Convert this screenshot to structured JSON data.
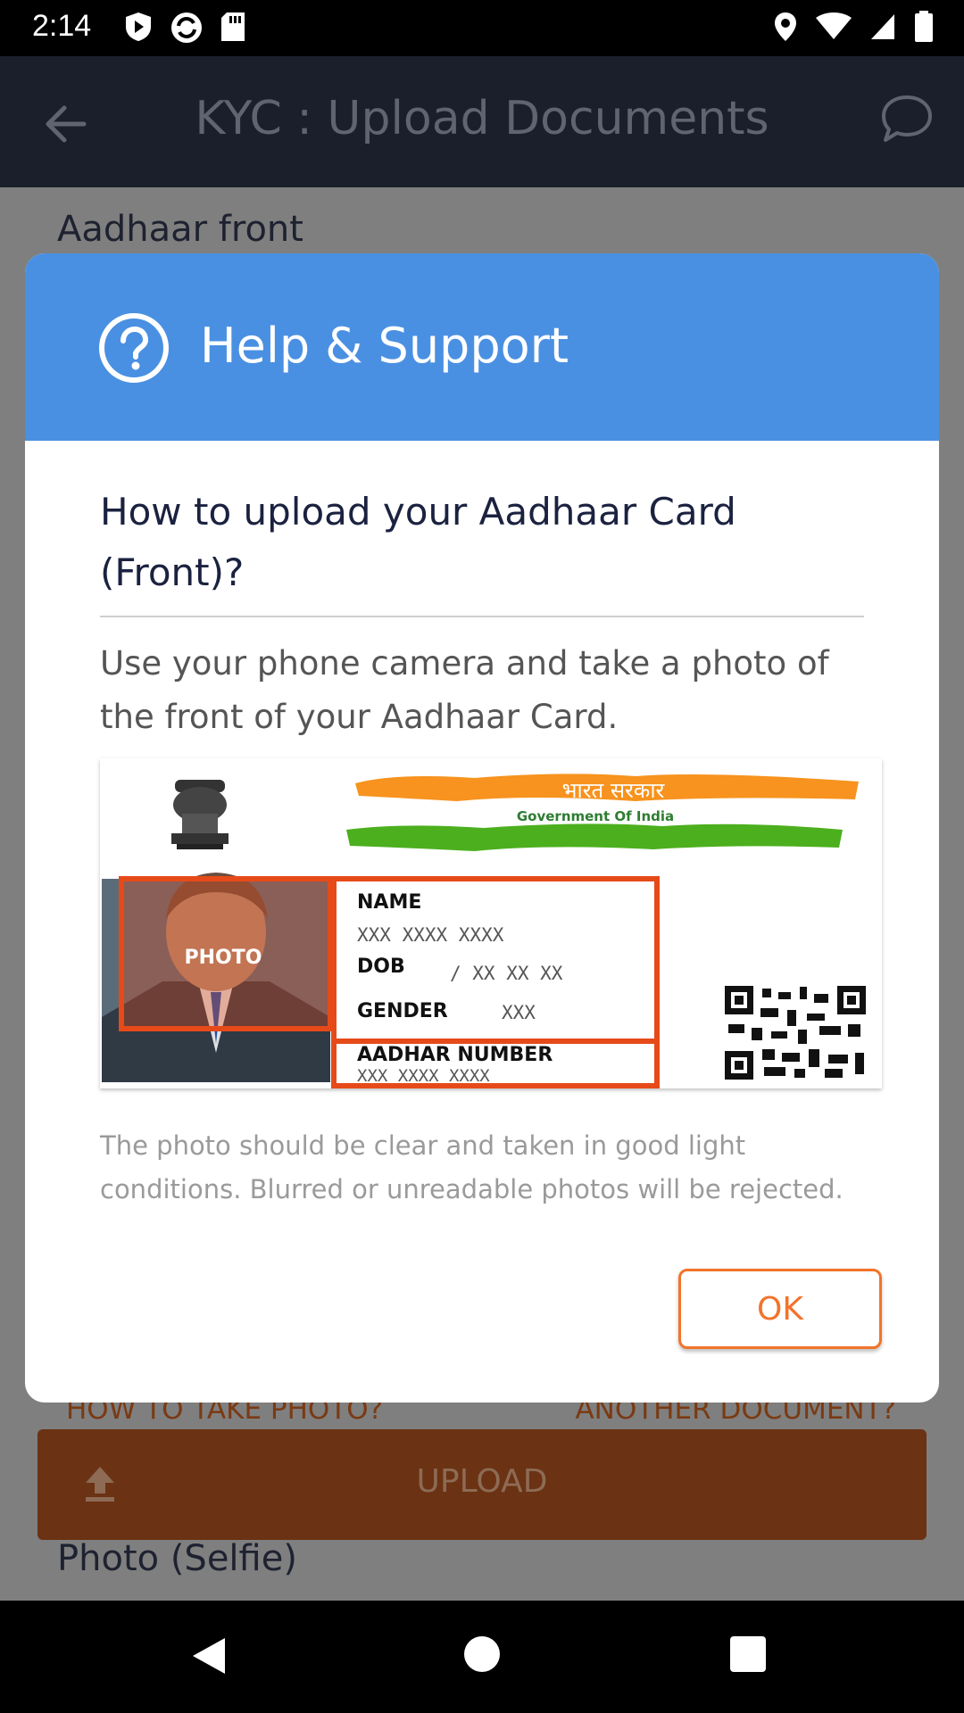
{
  "status_bar": {
    "time": "2:14"
  },
  "app_bar": {
    "title": "KYC : Upload Documents"
  },
  "background": {
    "section_label": "Aadhaar front",
    "how_to_link": "HOW TO TAKE PHOTO?",
    "another_doc_link": "ANOTHER DOCUMENT?",
    "upload_label": "UPLOAD",
    "next_section_label": "Photo (Selfie)"
  },
  "dialog": {
    "title": "Help & Support",
    "question": "How to upload your Aadhaar Card (Front)?",
    "instruction": "Use your phone camera and take a photo of the front of your Aadhaar Card.",
    "card": {
      "hindi_title": "भारत सरकार",
      "gov_label": "Government Of India",
      "photo_label": "PHOTO",
      "name_label": "NAME",
      "name_value": "XXX XXXX XXXX",
      "dob_label": "DOB",
      "dob_value": "/ XX XX XX",
      "gender_label": "GENDER",
      "gender_value": "XXX",
      "aadhar_label": "AADHAR NUMBER",
      "aadhar_value": "XXX XXXX XXXX"
    },
    "note": "The photo should be clear and taken in good light conditions. Blurred or unreadable photos will be rejected.",
    "ok_label": "OK"
  },
  "colors": {
    "header_blue": "#4a90e2",
    "accent_orange": "#f2732a",
    "card_red": "#e64a19"
  }
}
